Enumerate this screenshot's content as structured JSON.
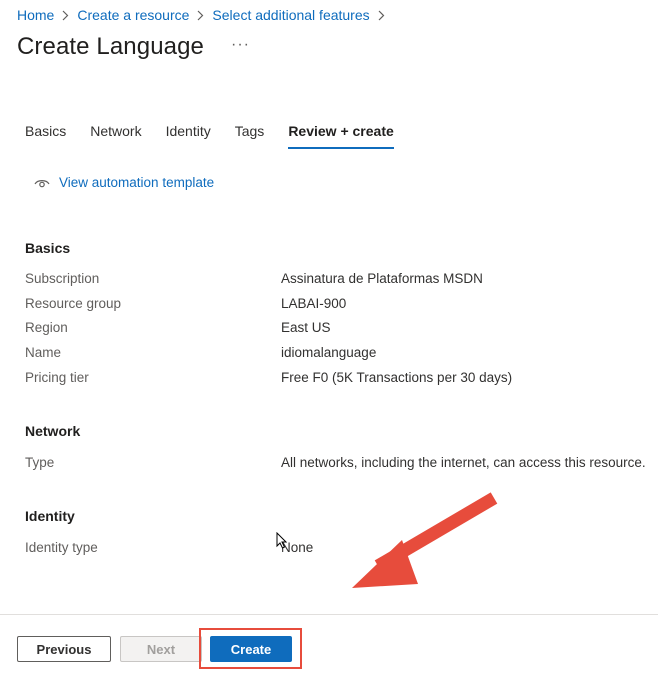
{
  "breadcrumb": {
    "items": [
      "Home",
      "Create a resource",
      "Select additional features"
    ]
  },
  "header": {
    "title": "Create Language",
    "more": "···"
  },
  "tabs": [
    {
      "label": "Basics",
      "active": false
    },
    {
      "label": "Network",
      "active": false
    },
    {
      "label": "Identity",
      "active": false
    },
    {
      "label": "Tags",
      "active": false
    },
    {
      "label": "Review + create",
      "active": true
    }
  ],
  "automation": {
    "label": "View automation template",
    "icon": "eye-icon"
  },
  "sections": {
    "basics": {
      "title": "Basics",
      "rows": [
        {
          "label": "Subscription",
          "value": "Assinatura de Plataformas MSDN"
        },
        {
          "label": "Resource group",
          "value": "LABAI-900"
        },
        {
          "label": "Region",
          "value": "East US"
        },
        {
          "label": "Name",
          "value": "idiomalanguage"
        },
        {
          "label": "Pricing tier",
          "value": "Free F0 (5K Transactions per 30 days)"
        }
      ]
    },
    "network": {
      "title": "Network",
      "rows": [
        {
          "label": "Type",
          "value": "All networks, including the internet, can access this resource."
        }
      ]
    },
    "identity": {
      "title": "Identity",
      "rows": [
        {
          "label": "Identity type",
          "value": "None"
        }
      ]
    }
  },
  "footer": {
    "previous_label": "Previous",
    "next_label": "Next",
    "create_label": "Create"
  },
  "colors": {
    "accent": "#0f6cbd",
    "annotation": "#e74c3c"
  }
}
